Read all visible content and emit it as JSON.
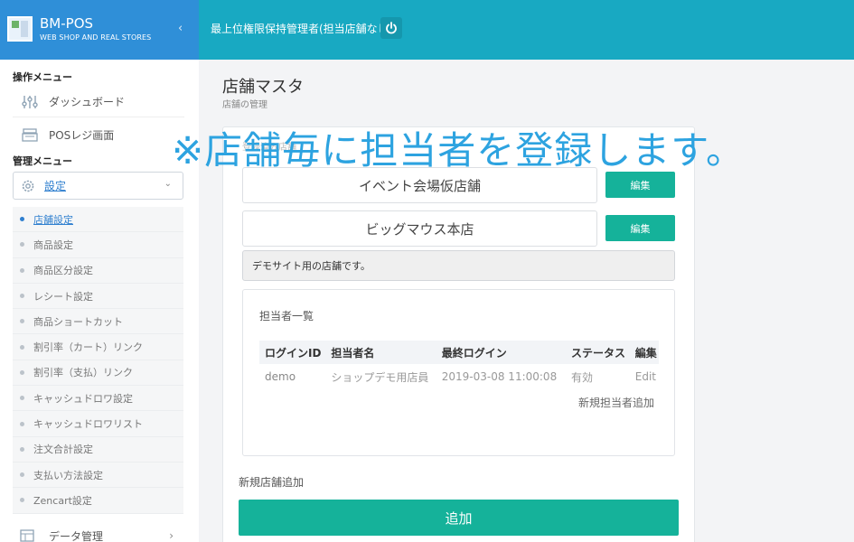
{
  "brand": {
    "title": "BM-POS",
    "subtitle": "WEB SHOP AND REAL STORES",
    "collapse_icon": "‹"
  },
  "topbar": {
    "user_text": "最上位権限保持管理者(担当店舗なし)"
  },
  "sidebar": {
    "ops_title": "操作メニュー",
    "ops_items": [
      {
        "label": "ダッシュボード",
        "icon": "sliders-icon"
      },
      {
        "label": "POSレジ画面",
        "icon": "register-icon"
      }
    ],
    "admin_title": "管理メニュー",
    "settings_label": "設定",
    "settings_chevron": "⌄",
    "sub_items": [
      "店舗設定",
      "商品設定",
      "商品区分設定",
      "レシート設定",
      "商品ショートカット",
      "割引率（カート）リンク",
      "割引率（支払）リンク",
      "キャッシュドロワ設定",
      "キャッシュドロワリスト",
      "注文合計設定",
      "支払い方法設定",
      "Zencart設定"
    ],
    "data_label": "データ管理",
    "data_chevron": "›"
  },
  "page": {
    "title": "店舗マスタ",
    "subtitle": "店舗の管理",
    "panel_caption": "登録済み店舗"
  },
  "stores": [
    {
      "name": "イベント会場仮店舗",
      "edit_label": "編集"
    },
    {
      "name": "ビッグマウス本店",
      "edit_label": "編集"
    }
  ],
  "note": "デモサイト用の店舗です。",
  "staff": {
    "title": "担当者一覧",
    "columns": [
      "ログインID",
      "担当者名",
      "最終ログイン",
      "ステータス",
      "編集"
    ],
    "rows": [
      [
        "demo",
        "ショップデモ用店員",
        "2019-03-08 11:00:08",
        "有効",
        "Edit"
      ]
    ],
    "add_label": "新規担当者追加"
  },
  "new_store_label": "新規店舗追加",
  "add_button": "追加",
  "overlay_text": "※店舗毎に担当者を登録します。",
  "colors": {
    "brand": "#2f8fd8",
    "topbar": "#18a9c2",
    "accent": "#15b29a",
    "overlay": "#2da3e0"
  }
}
